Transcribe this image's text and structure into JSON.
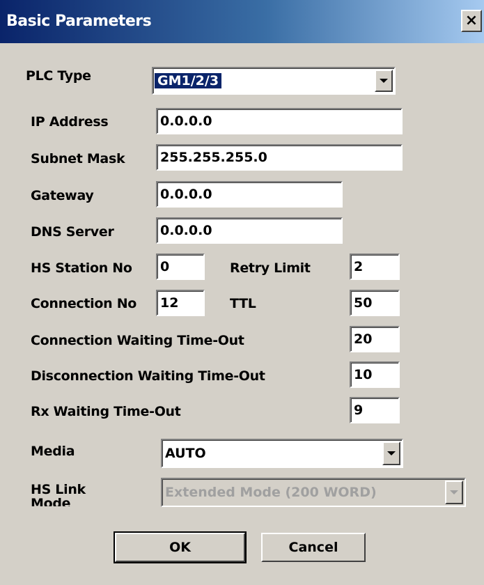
{
  "window": {
    "title": "Basic Parameters",
    "close_glyph": "×"
  },
  "labels": {
    "plc_type": "PLC Type",
    "ip_address": "IP Address",
    "subnet_mask": "Subnet Mask",
    "gateway": "Gateway",
    "dns_server": "DNS Server",
    "hs_station_no": "HS Station No",
    "retry_limit": "Retry Limit",
    "connection_no": "Connection No",
    "ttl": "TTL",
    "connection_timeout": "Connection Waiting Time-Out",
    "disconnection_timeout": "Disconnection Waiting Time-Out",
    "rx_timeout": "Rx Waiting Time-Out",
    "media": "Media",
    "hs_link_mode": "HS Link Mode"
  },
  "values": {
    "plc_type": "GM1/2/3",
    "ip_address": "0.0.0.0",
    "subnet_mask": "255.255.255.0",
    "gateway": "0.0.0.0",
    "dns_server": "0.0.0.0",
    "hs_station_no": "0",
    "retry_limit": "2",
    "connection_no": "12",
    "ttl": "50",
    "connection_timeout": "20",
    "disconnection_timeout": "10",
    "rx_timeout": "9",
    "media": "AUTO",
    "hs_link_mode": "Extended Mode (200 WORD)"
  },
  "buttons": {
    "ok": "OK",
    "cancel": "Cancel"
  },
  "icons": {
    "dropdown": "chevron-down-icon",
    "close": "close-icon"
  },
  "colors": {
    "titlebar_start": "#0a246a",
    "titlebar_end": "#a6caf0",
    "dialog_bg": "#d4d0c8",
    "selection": "#0a246a",
    "disabled_text": "#a0a0a0"
  }
}
